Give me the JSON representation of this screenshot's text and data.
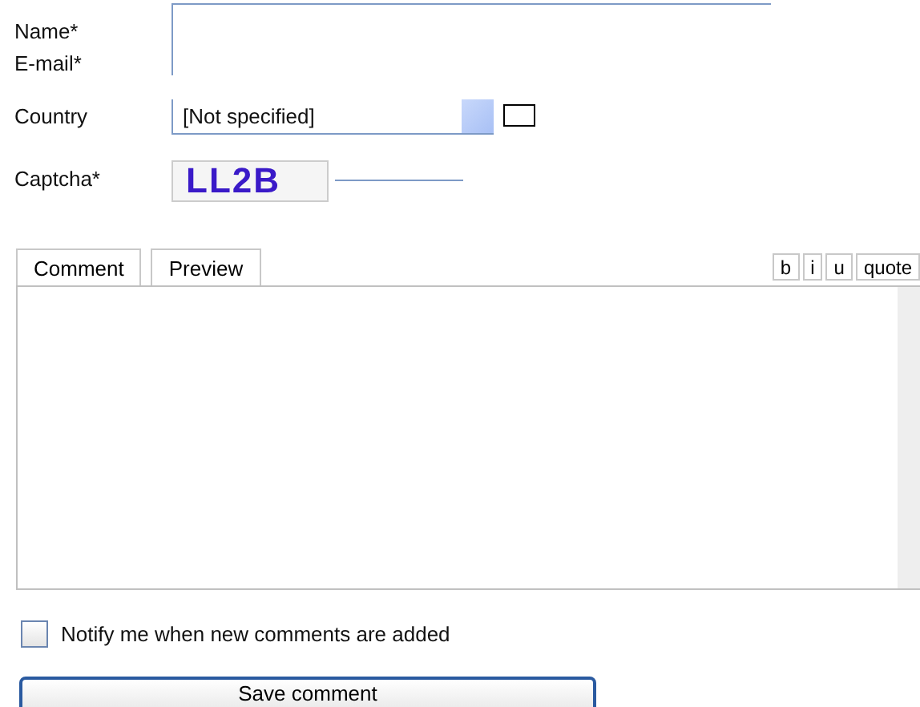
{
  "fields": [
    {
      "label": "Name*"
    },
    {
      "label": "E-mail*"
    }
  ],
  "country": {
    "label": "Country",
    "value": "[Not specified]"
  },
  "captcha": {
    "label": "Captcha*",
    "text": "LL2B"
  },
  "tabs": [
    {
      "label": "Comment"
    },
    {
      "label": "Preview"
    }
  ],
  "format_buttons": [
    "b",
    "i",
    "u",
    "quote"
  ],
  "notify": {
    "label": "Notify me when new comments are added",
    "checked": false
  },
  "submit": "Save comment"
}
